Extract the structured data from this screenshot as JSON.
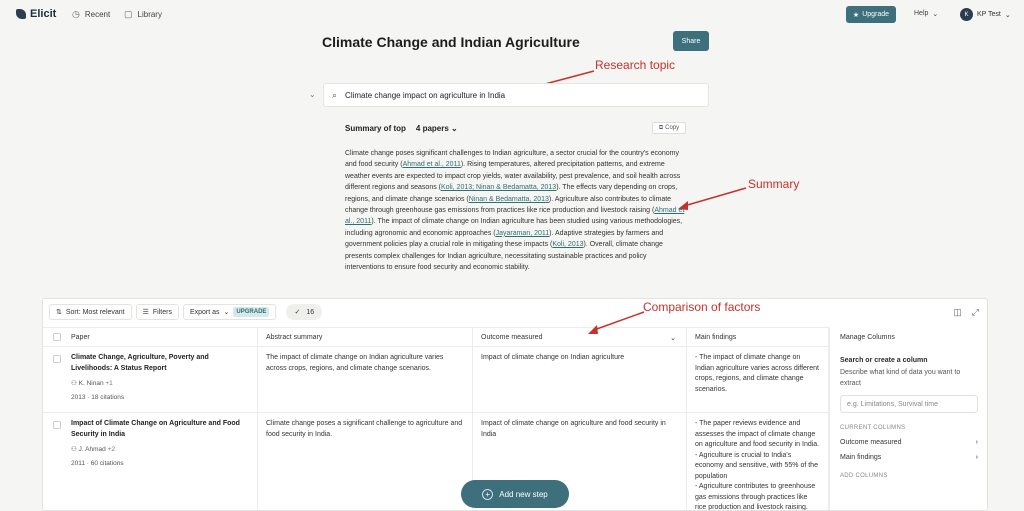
{
  "header": {
    "app_name": "Elicit",
    "nav": [
      {
        "label": "Recent",
        "icon": "clock-icon"
      },
      {
        "label": "Library",
        "icon": "book-icon"
      }
    ],
    "upgrade_label": "Upgrade",
    "help_label": "Help",
    "user_initial": "K",
    "user_name": "KP Test"
  },
  "title": "Climate Change and Indian Agriculture",
  "share_label": "Share",
  "annotations": {
    "research_topic": "Research topic",
    "summary": "Summary",
    "comparison": "Comparison of factors",
    "color": "#c9302c"
  },
  "search": {
    "query": "Climate change impact on agriculture in India"
  },
  "summary": {
    "heading": "Summary of top",
    "papers_selector": "4 papers",
    "copy_label": "Copy",
    "parts": [
      {
        "t": "Climate change poses significant challenges to Indian agriculture, a sector crucial for the country's economy and food security (",
        "c": false
      },
      {
        "t": "Ahmad et al., 2011",
        "c": true
      },
      {
        "t": "). Rising temperatures, altered precipitation patterns, and extreme weather events are expected to impact crop yields, water availability, pest prevalence, and soil health across different regions and seasons (",
        "c": false
      },
      {
        "t": "Koli, 2013; Ninan & Bedamatta, 2013",
        "c": true
      },
      {
        "t": "). The effects vary depending on crops, regions, and climate change scenarios (",
        "c": false
      },
      {
        "t": "Ninan & Bedamatta, 2013",
        "c": true
      },
      {
        "t": "). Agriculture also contributes to climate change through greenhouse gas emissions from practices like rice production and livestock raising (",
        "c": false
      },
      {
        "t": "Ahmad et al., 2011",
        "c": true
      },
      {
        "t": "). The impact of climate change on Indian agriculture has been studied using various methodologies, including agronomic and economic approaches (",
        "c": false
      },
      {
        "t": "Jayaraman, 2011",
        "c": true
      },
      {
        "t": "). Adaptive strategies by farmers and government policies play a crucial role in mitigating these impacts (",
        "c": false
      },
      {
        "t": "Koli, 2013",
        "c": true
      },
      {
        "t": "). Overall, climate change presents complex challenges for Indian agriculture, necessitating sustainable practices and policy interventions to ensure food security and economic stability.",
        "c": false
      }
    ]
  },
  "toolbar": {
    "sort_label": "Sort: Most relevant",
    "filters_label": "Filters",
    "export_label": "Export as",
    "upgrade_badge": "UPGRADE",
    "selected_count": "16"
  },
  "table": {
    "columns": [
      "Paper",
      "Abstract summary",
      "Outcome measured",
      "Main findings"
    ],
    "rows": [
      {
        "title": "Climate Change, Agriculture, Poverty and Livelihoods: A Status Report",
        "author": "K. Ninan",
        "more_authors": "+1",
        "year": "2013",
        "citations": "18 citations",
        "abstract": "The impact of climate change on Indian agriculture varies across crops, regions, and climate change scenarios.",
        "outcome": "Impact of climate change on Indian agriculture",
        "findings": "- The impact of climate change on Indian agriculture varies across different crops, regions, and climate change scenarios."
      },
      {
        "title": "Impact of Climate Change on Agriculture and Food Security in India",
        "author": "J. Ahmad",
        "more_authors": "+2",
        "year": "2011",
        "citations": "60 citations",
        "abstract": "Climate change poses a significant challenge to agriculture and food security in India.",
        "outcome": "Impact of climate change on agriculture and food security in India",
        "findings": "- The paper reviews evidence and assesses the impact of climate change on agriculture and food security in India.\n- Agriculture is crucial to India's economy and sensitive, with 55% of the population\n- Agriculture contributes to greenhouse gas emissions through practices like rice production and livestock raising."
      }
    ]
  },
  "manage_columns": {
    "title": "Manage Columns",
    "search_title": "Search or create a column",
    "desc": "Describe what kind of data you want to extract",
    "placeholder": "e.g. Limitations, Survival time",
    "current_label": "CURRENT COLUMNS",
    "current": [
      "Outcome measured",
      "Main findings"
    ],
    "add_label": "ADD COLUMNS"
  },
  "new_step_label": "Add new step"
}
